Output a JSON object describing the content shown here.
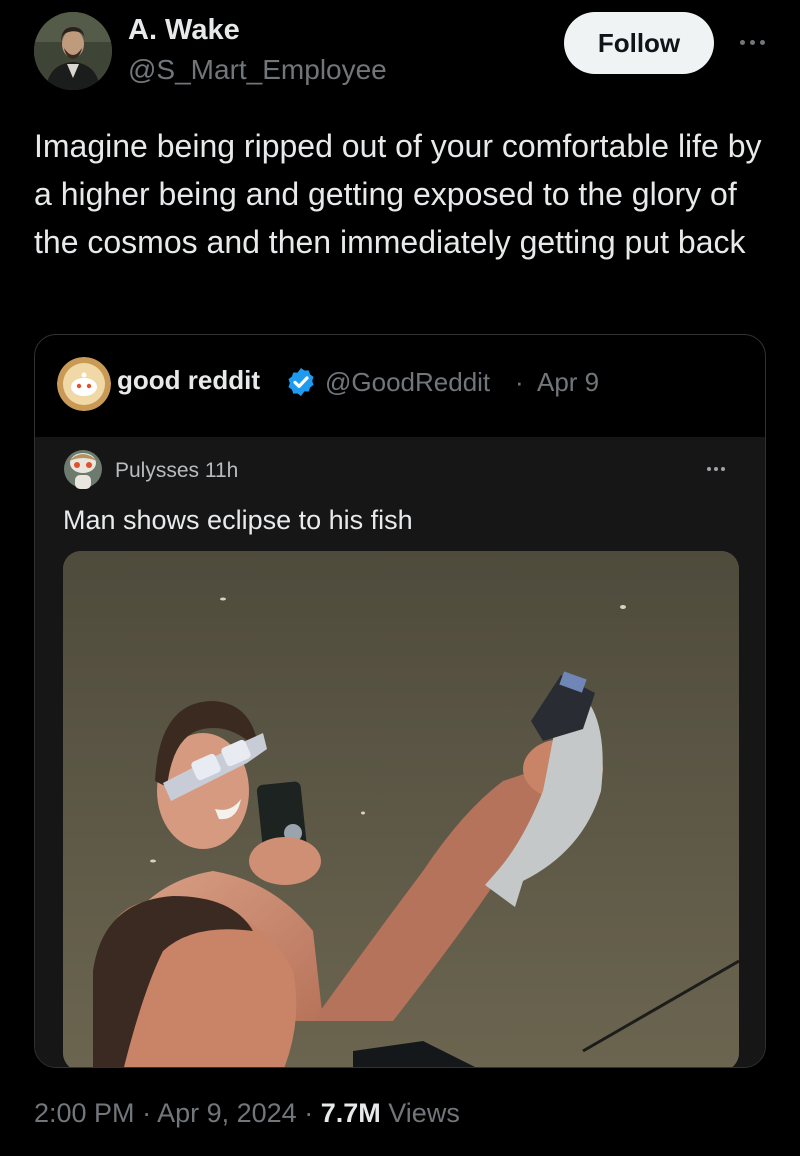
{
  "author": {
    "name": "A. Wake",
    "handle": "@S_Mart_Employee",
    "follow_label": "Follow"
  },
  "tweet": {
    "text": "Imagine being ripped out of your comfortable life by a higher being and getting exposed to the glory of the cosmos and then immediately getting put back"
  },
  "quote": {
    "name": "good reddit",
    "verified": true,
    "handle": "@GoodReddit",
    "separator": "·",
    "date": "Apr 9",
    "reddit_post": {
      "user": "Pulysses",
      "age": "11h",
      "title": "Man shows eclipse to his fish"
    }
  },
  "meta": {
    "time": "2:00 PM",
    "sep1": "·",
    "date": "Apr 9, 2024",
    "sep2": "·",
    "views_count": "7.7M",
    "views_label": "Views"
  },
  "colors": {
    "background": "#000000",
    "text_primary": "#e7e9ea",
    "text_secondary": "#71767b",
    "verified_badge": "#1d9bf0",
    "follow_bg": "#eff3f4"
  },
  "icons": [
    "verified-badge-icon",
    "more-icon",
    "reddit-avatar-icon"
  ]
}
